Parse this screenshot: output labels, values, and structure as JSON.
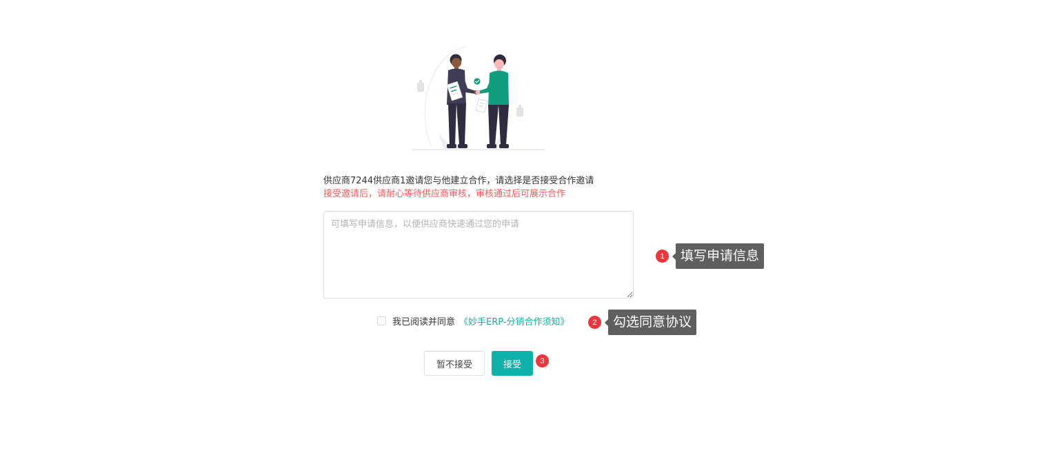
{
  "invitation": {
    "message": "供应商7244供应商1邀请您与他建立合作，请选择是否接受合作邀请",
    "warning": "接受邀请后，请耐心等待供应商审核，审核通过后可展示合作"
  },
  "form": {
    "application_placeholder": "可填写申请信息，以便供应商快速通过您的申请",
    "application_value": "",
    "agreement_prefix": "我已阅读并同意",
    "agreement_link": "《妙手ERP-分销合作须知》",
    "agreement_checked": false
  },
  "buttons": {
    "reject_label": "暂不接受",
    "accept_label": "接受"
  },
  "guide_steps": [
    {
      "number": "1",
      "tip": "填写申请信息"
    },
    {
      "number": "2",
      "tip": "勾选同意协议"
    },
    {
      "number": "3",
      "tip": ""
    }
  ],
  "colors": {
    "accent": "#0fb2aa",
    "link": "#13b1a5",
    "warning_text": "#f15b5b",
    "step_badge": "#f0343b",
    "tooltip_bg": "#5f5f5f",
    "person_shirt_green": "#119e7e",
    "person_dark": "#2f2e41"
  },
  "icons": {
    "illustration": "handshake-illustration",
    "check": "check-circle-icon"
  }
}
